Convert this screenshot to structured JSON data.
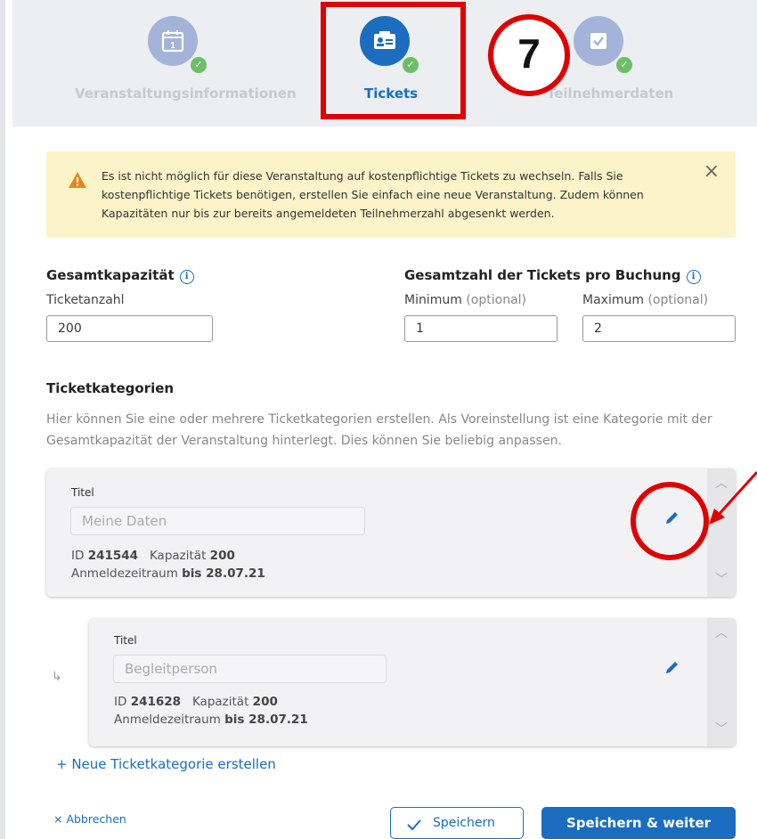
{
  "stepper": {
    "steps": [
      {
        "label": "Veranstaltungsinformationen",
        "state": "done",
        "icon": "calendar-icon"
      },
      {
        "label": "Tickets",
        "state": "active",
        "icon": "ticket-id-card-icon"
      },
      {
        "label": "Teilnehmerdaten",
        "state": "done",
        "icon": "checkbox-icon"
      }
    ],
    "check_glyph": "✓"
  },
  "annotation": {
    "step_number": "7",
    "color": "#e00000"
  },
  "alert": {
    "text": "Es ist nicht möglich für diese Veranstaltung auf kostenpflichtige Tickets zu wechseln. Falls Sie kostenpflichtige Tickets benötigen, erstellen Sie einfach eine neue Veranstaltung. Zudem können Kapazitäten nur bis zur bereits angemeldeten Teilnehmerzahl abgesenkt werden.",
    "close_glyph": "×"
  },
  "capacity": {
    "heading": "Gesamtkapazität",
    "label": "Ticketanzahl",
    "value": "200"
  },
  "per_booking": {
    "heading": "Gesamtzahl der Tickets pro Buchung",
    "min_label": "Minimum",
    "max_label": "Maximum",
    "optional": "(optional)",
    "min_value": "1",
    "max_value": "2"
  },
  "categories": {
    "heading": "Ticketkategorien",
    "description": "Hier können Sie eine oder mehrere Ticketkategorien erstellen. Als Voreinstellung ist eine Kategorie mit der Gesamtkapazität der Veranstaltung hinterlegt. Dies können Sie beliebig anpassen.",
    "items": [
      {
        "title_label": "Titel",
        "title_value": "Meine Daten",
        "id_label": "ID",
        "id": "241544",
        "cap_label": "Kapazität",
        "capacity": "200",
        "period_label": "Anmeldezeitraum",
        "period": "bis 28.07.21"
      },
      {
        "title_label": "Titel",
        "title_value": "Begleitperson",
        "id_label": "ID",
        "id": "241628",
        "cap_label": "Kapazität",
        "capacity": "200",
        "period_label": "Anmeldezeitraum",
        "period": "bis 28.07.21"
      }
    ],
    "add_link": "+ Neue Ticketkategorie erstellen",
    "child_glyph": "↳"
  },
  "footer": {
    "cancel": "× Abbrechen",
    "save": "Speichern",
    "save_next": "Speichern & weiter"
  },
  "colors": {
    "primary": "#1a6dbf",
    "success": "#6dbf67",
    "warning_bg": "#fcf3c9",
    "warning_icon": "#e08a1e"
  }
}
